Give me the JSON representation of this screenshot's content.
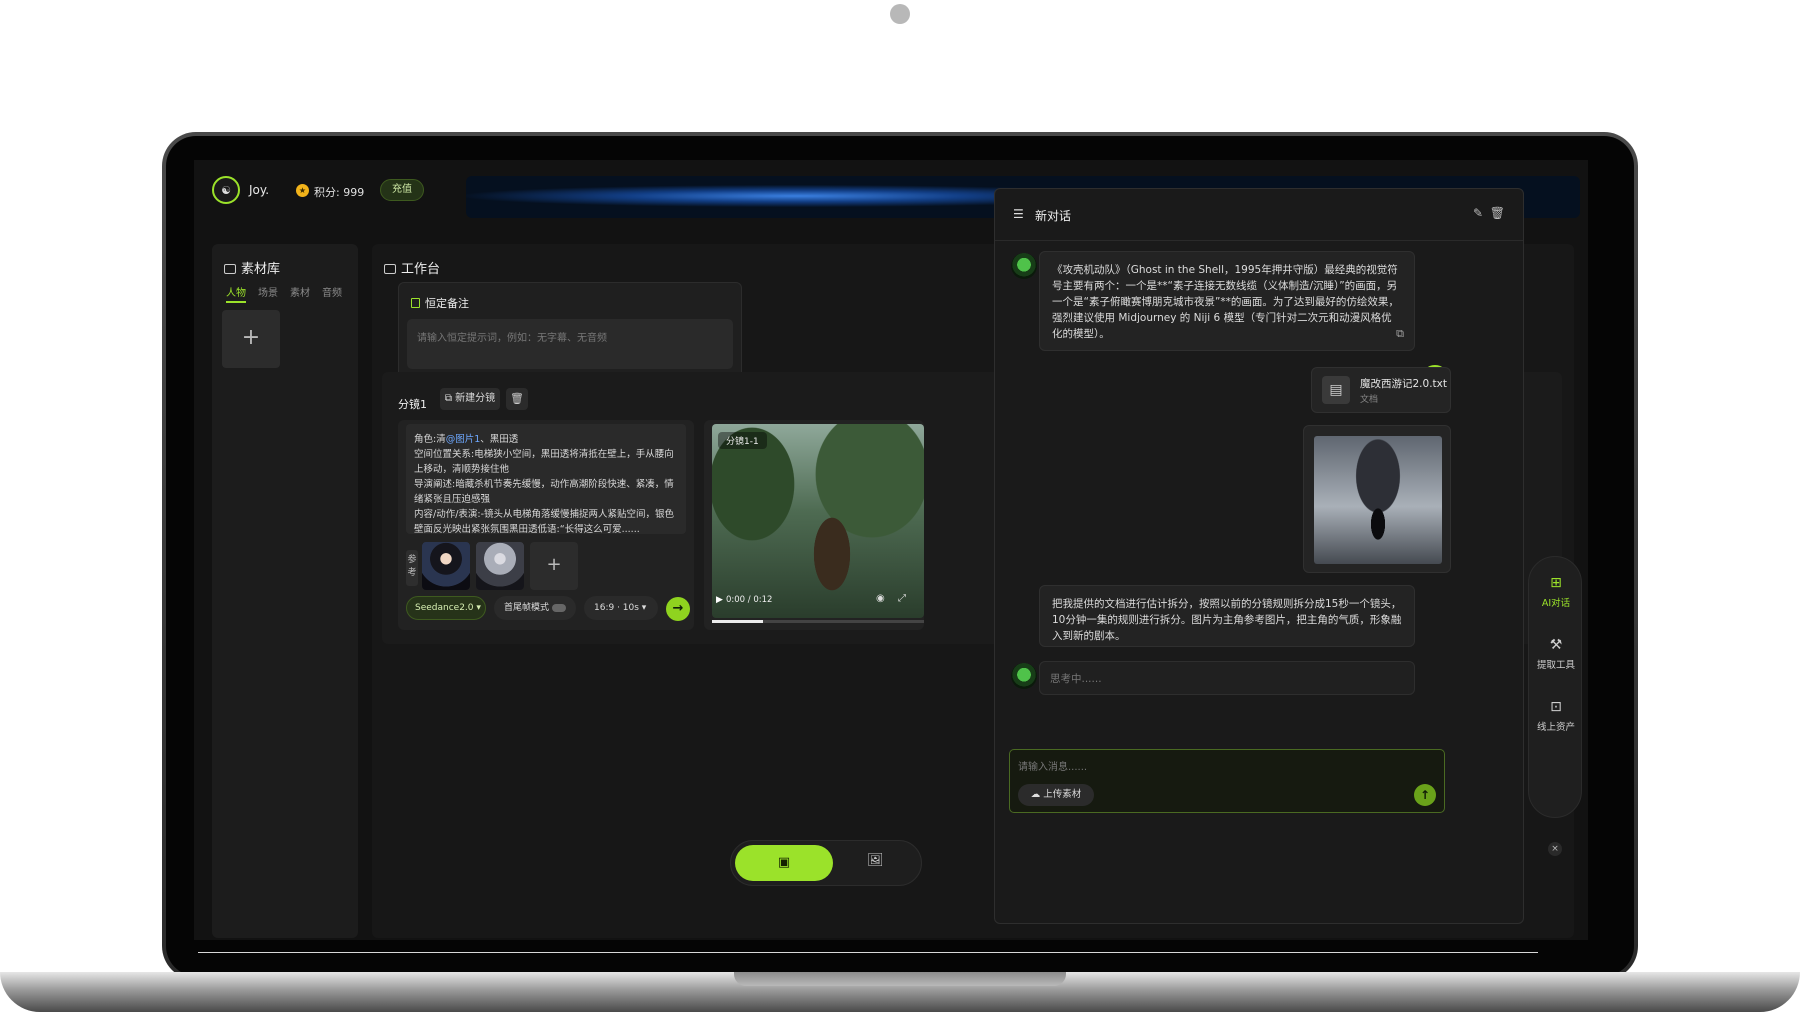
{
  "topbar": {
    "user_name": "Joy.",
    "points_label": "积分: 999",
    "recharge_label": "充值"
  },
  "library": {
    "title": "素材库",
    "tabs": [
      "人物",
      "场景",
      "素材",
      "音频"
    ],
    "active_tab": "人物"
  },
  "workbench": {
    "title": "工作台",
    "note": {
      "title": "恒定备注",
      "placeholder": "请输入恒定提示词，例如：无字幕、无音频"
    },
    "storyboard": {
      "label": "分镜1",
      "new_button": "新建分镜",
      "prompt_prefix": "角色:清",
      "prompt_ref": "@图片1",
      "prompt_body": "、黑田透\n空间位置关系:电梯狭小空间，黑田透将清抵在壁上，手从腰向上移动，清顺势接住他\n导演阐述:暗藏杀机节奏先缓慢，动作高潮阶段快速、紧凑，情绪紧张且压迫感强\n内容/动作/表演:-镜头从电梯角落缓慢捕捉两人紧贴空间，银色壁面反光映出紧张氛围黑田透低语:“长得这么可爱......",
      "ref_label": "参考",
      "model": "Seedance2.0",
      "mode_label": "首尾帧模式",
      "ratio": "16:9 · 10s",
      "video_tag": "分镜1-1",
      "video_time": "0:00 / 0:12",
      "video_progress": 0.24
    }
  },
  "mode_bar": {
    "active": "video"
  },
  "tools": [
    {
      "label": "AI对话",
      "active": true
    },
    {
      "label": "提取工具",
      "active": false
    },
    {
      "label": "线上资产",
      "active": false
    }
  ],
  "chat": {
    "title": "新对话",
    "messages": {
      "bot_reply": "《攻壳机动队》（Ghost in the Shell，1995年押井守版）最经典的视觉符号主要有两个：一个是**“素子连接无数线缆（义体制造/沉睡）”的画面，另一个是“素子俯瞰赛博朋克城市夜景”**的画面。为了达到最好的仿绘效果，强烈建议使用 Midjourney 的 Niji 6 模型（专门针对二次元和动漫风格优化的模型）。",
      "file_name": "魔改西游记2.0.txt",
      "file_type": "文档",
      "user_text": "把我提供的文档进行估计拆分，按照以前的分镜规则拆分成15秒一个镜头，10分钟一集的规则进行拆分。图片为主角参考图片，把主角的气质，形象融入到新的剧本。",
      "thinking": "思考中......"
    },
    "composer_placeholder": "请输入消息......",
    "upload_label": "上传素材"
  }
}
